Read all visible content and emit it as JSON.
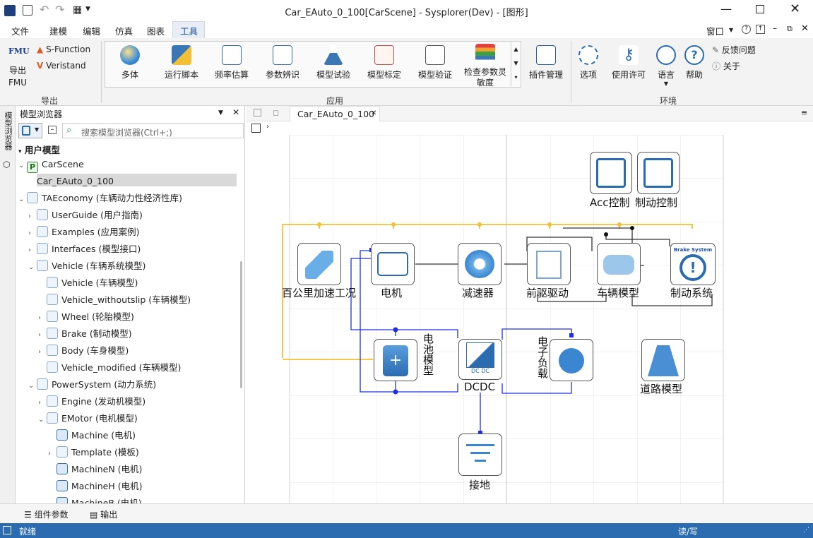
{
  "window": {
    "title": "Car_EAuto_0_100[CarScene] - Sysplorer(Dev) - [图形]"
  },
  "menu": {
    "items": [
      "文件",
      "建模",
      "编辑",
      "仿真",
      "图表",
      "工具"
    ],
    "active": "工具",
    "right": "窗口"
  },
  "ribbon": {
    "export": {
      "fmu": "FMU",
      "export_fmu_line1": "导出",
      "export_fmu_line2": "FMU",
      "sfunction": "S-Function",
      "veristand": "Veristand",
      "group": "导出"
    },
    "apps": [
      {
        "label": "多体"
      },
      {
        "label": "运行脚本"
      },
      {
        "label": "频率估算"
      },
      {
        "label": "参数辨识"
      },
      {
        "label": "模型试验"
      },
      {
        "label": "模型标定"
      },
      {
        "label": "模型验证"
      },
      {
        "label": "检查参数灵敏度"
      }
    ],
    "apps_group": "应用",
    "plugin": "插件管理",
    "env": [
      {
        "label": "选项"
      },
      {
        "label": "使用许可"
      },
      {
        "label": "语言"
      },
      {
        "label": "帮助"
      }
    ],
    "feedback": "反馈问题",
    "about": "关于",
    "env_group": "环境"
  },
  "browser": {
    "side_tab": "模型浏览器",
    "title": "模型浏览器",
    "search_placeholder": "搜索模型浏览器(Ctrl+;)",
    "section": "用户模型",
    "rows": [
      {
        "text": "CarScene",
        "arrow": "v",
        "depth": 0
      },
      {
        "text": "Car_EAuto_0_100",
        "arrow": "",
        "depth": 1
      },
      {
        "text": "TAEconomy (车辆动力性经济性库)",
        "arrow": "v",
        "depth": 0
      },
      {
        "text": "UserGuide (用户指南)",
        "arrow": ">",
        "depth": 1
      },
      {
        "text": "Examples (应用案例)",
        "arrow": ">",
        "depth": 1
      },
      {
        "text": "Interfaces (模型接口)",
        "arrow": ">",
        "depth": 1
      },
      {
        "text": "Vehicle (车辆系统模型)",
        "arrow": "v",
        "depth": 1
      },
      {
        "text": "Vehicle (车辆模型)",
        "arrow": "",
        "depth": 2
      },
      {
        "text": "Vehicle_withoutslip (车辆模型)",
        "arrow": "",
        "depth": 2
      },
      {
        "text": "Wheel (轮胎模型)",
        "arrow": ">",
        "depth": 2
      },
      {
        "text": "Brake (制动模型)",
        "arrow": ">",
        "depth": 2
      },
      {
        "text": "Body (车身模型)",
        "arrow": ">",
        "depth": 2
      },
      {
        "text": "Vehicle_modified (车辆模型)",
        "arrow": "",
        "depth": 2
      },
      {
        "text": "PowerSystem (动力系统)",
        "arrow": "v",
        "depth": 1
      },
      {
        "text": "Engine (发动机模型)",
        "arrow": ">",
        "depth": 2
      },
      {
        "text": "EMotor (电机模型)",
        "arrow": "v",
        "depth": 2
      },
      {
        "text": "Machine (电机)",
        "arrow": "",
        "depth": 3
      },
      {
        "text": "Template (模板)",
        "arrow": ">",
        "depth": 3
      },
      {
        "text": "MachineN (电机)",
        "arrow": "",
        "depth": 3
      },
      {
        "text": "MachineH (电机)",
        "arrow": "",
        "depth": 3
      },
      {
        "text": "MachineB (电机)",
        "arrow": "",
        "depth": 3
      }
    ]
  },
  "canvas": {
    "tab": "Car_EAuto_0_100",
    "blocks": {
      "acc": "Acc控制",
      "brakectl": "制动控制",
      "cycle": "百公里加速工况",
      "motor": "电机",
      "reducer": "减速器",
      "fwd": "前驱驱动",
      "vehicle": "车辆模型",
      "brakesys": "制动系统",
      "battery": "电池模型",
      "dcdc": "DCDC",
      "dcdc_small": "DC DC",
      "eload": "电子负载",
      "road": "道路模型",
      "ground": "接地",
      "brake_badge": "Brake System"
    }
  },
  "bottom": {
    "params": "组件参数",
    "output": "输出"
  },
  "status": {
    "left": "就绪",
    "right": "读/写"
  },
  "colors": {
    "accent": "#2b6cb0",
    "wire_yellow": "#f2c037",
    "wire_blue": "#2030e0"
  }
}
